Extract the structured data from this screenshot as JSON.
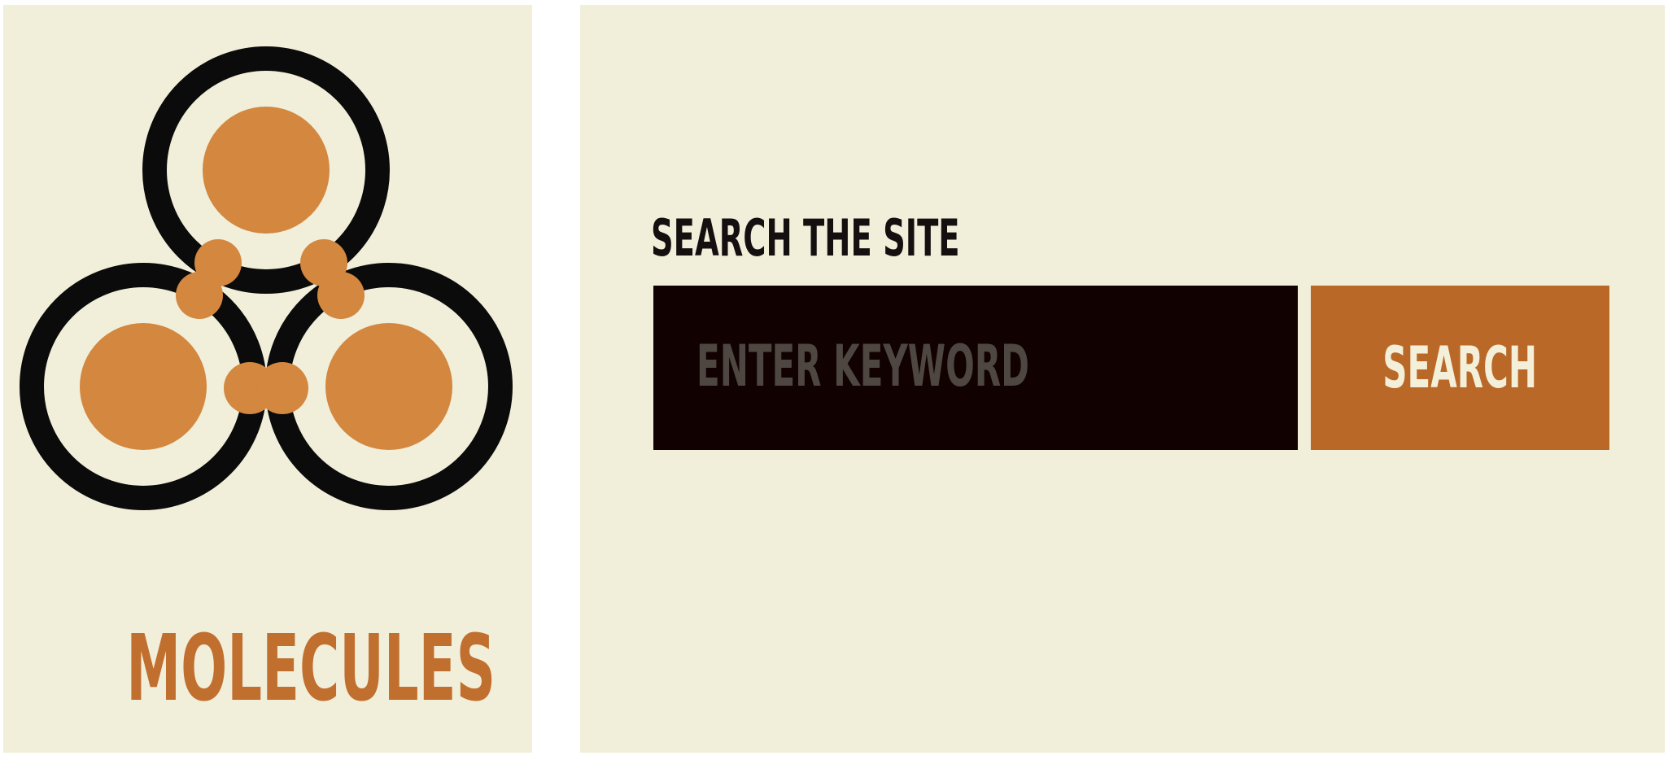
{
  "brand": {
    "name": "MOLECULES",
    "logo_icon": "molecule-icon"
  },
  "search": {
    "label": "SEARCH THE SITE",
    "input_placeholder": "ENTER KEYWORD",
    "input_value": "",
    "button_label": "SEARCH"
  },
  "colors": {
    "panel_background": "#f1eeda",
    "accent_orange": "#c16f2e",
    "button_orange": "#b96827",
    "input_background": "#110201",
    "placeholder_text": "#4e4641",
    "label_text": "#141010"
  }
}
